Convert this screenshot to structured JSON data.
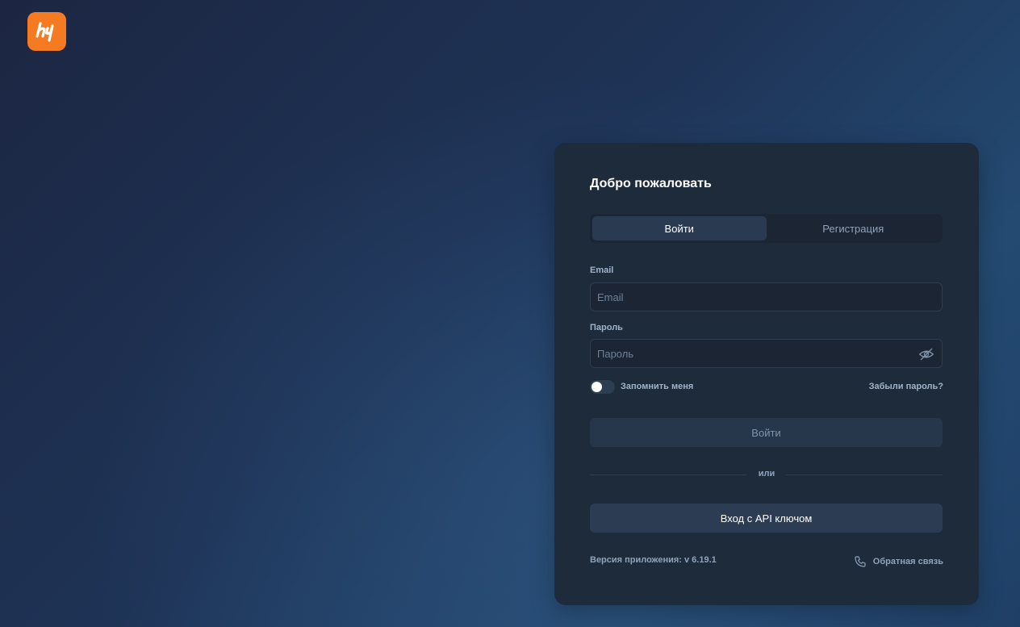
{
  "brand": {
    "logo_icon": "brand-logo-icon",
    "accent": "#f47b22"
  },
  "login": {
    "title": "Добро пожаловать",
    "tabs": [
      {
        "label": "Войти",
        "active": true
      },
      {
        "label": "Регистрация",
        "active": false
      }
    ],
    "email": {
      "label": "Email",
      "placeholder": "Email",
      "value": ""
    },
    "password": {
      "label": "Пароль",
      "placeholder": "Пароль",
      "value": "",
      "toggle_icon": "eye-off-icon"
    },
    "remember": {
      "label": "Запомнить меня",
      "checked": false
    },
    "forgot_label": "Забыли пароль?",
    "submit_label": "Войти",
    "divider_label": "или",
    "api_button_label": "Вход с API ключом",
    "version_text": "Версия приложения: v 6.19.1",
    "feedback": {
      "label": "Обратная связь",
      "icon": "phone-icon"
    }
  }
}
